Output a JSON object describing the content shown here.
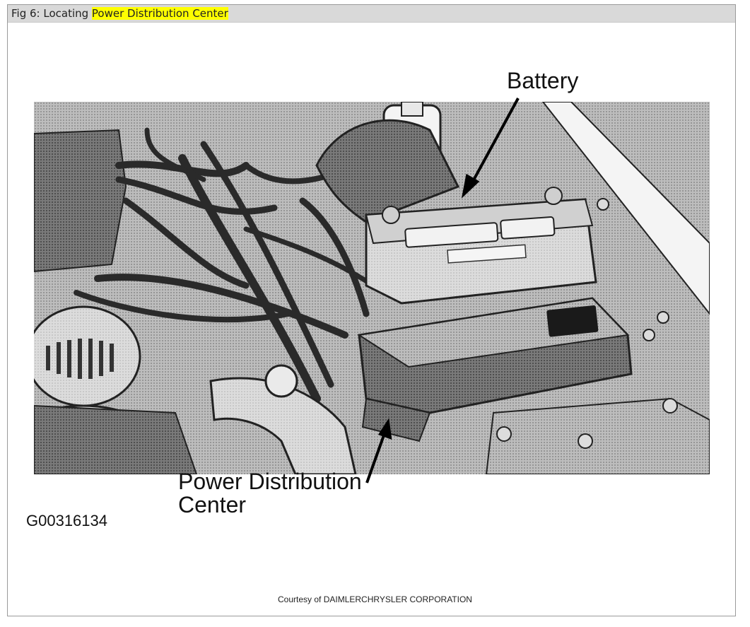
{
  "header": {
    "title_prefix": "Fig 6: Locating ",
    "title_highlight": "Power Distribution Center",
    "highlight_color": "#ffff00"
  },
  "figure": {
    "labels": {
      "battery": "Battery",
      "pdc_line1": "Power Distribution",
      "pdc_line2": "Center"
    },
    "figure_id": "G00316134"
  },
  "footer": {
    "courtesy": "Courtesy of DAIMLERCHRYSLER CORPORATION"
  }
}
